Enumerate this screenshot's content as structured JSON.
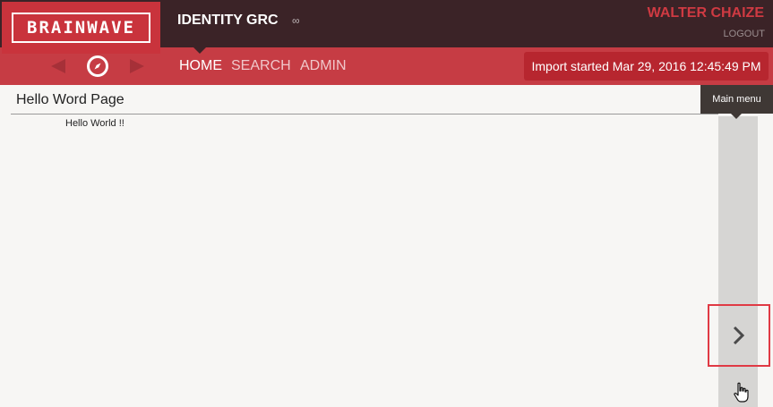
{
  "header": {
    "logo_text": "BRAINWAVE",
    "app_title": "IDENTITY GRC",
    "user_name": "WALTER CHAIZE",
    "logout_label": "LOGOUT"
  },
  "nav": {
    "items": [
      {
        "label": "HOME",
        "active": true
      },
      {
        "label": "SEARCH",
        "active": false
      },
      {
        "label": "ADMIN",
        "active": false
      }
    ],
    "import_status": "Import started Mar 29, 2016 12:45:49 PM"
  },
  "page": {
    "title": "Hello Word Page",
    "body_text": "Hello World !!"
  },
  "side_menu": {
    "tooltip": "Main menu"
  },
  "icons": {
    "back": "triangle-left",
    "forward": "triangle-right",
    "compass": "compass",
    "link": "link-chain",
    "toggle": "chevron-right",
    "cursor": "hand-pointer"
  },
  "colors": {
    "header_bg": "#3b2327",
    "nav_bg": "#c63c44",
    "brand_red": "#c9333c",
    "import_badge": "#b7262f",
    "user_name": "#cf3a42",
    "page_bg": "#f7f6f4",
    "rail_bg": "#d6d5d3",
    "highlight": "#e03a44"
  }
}
